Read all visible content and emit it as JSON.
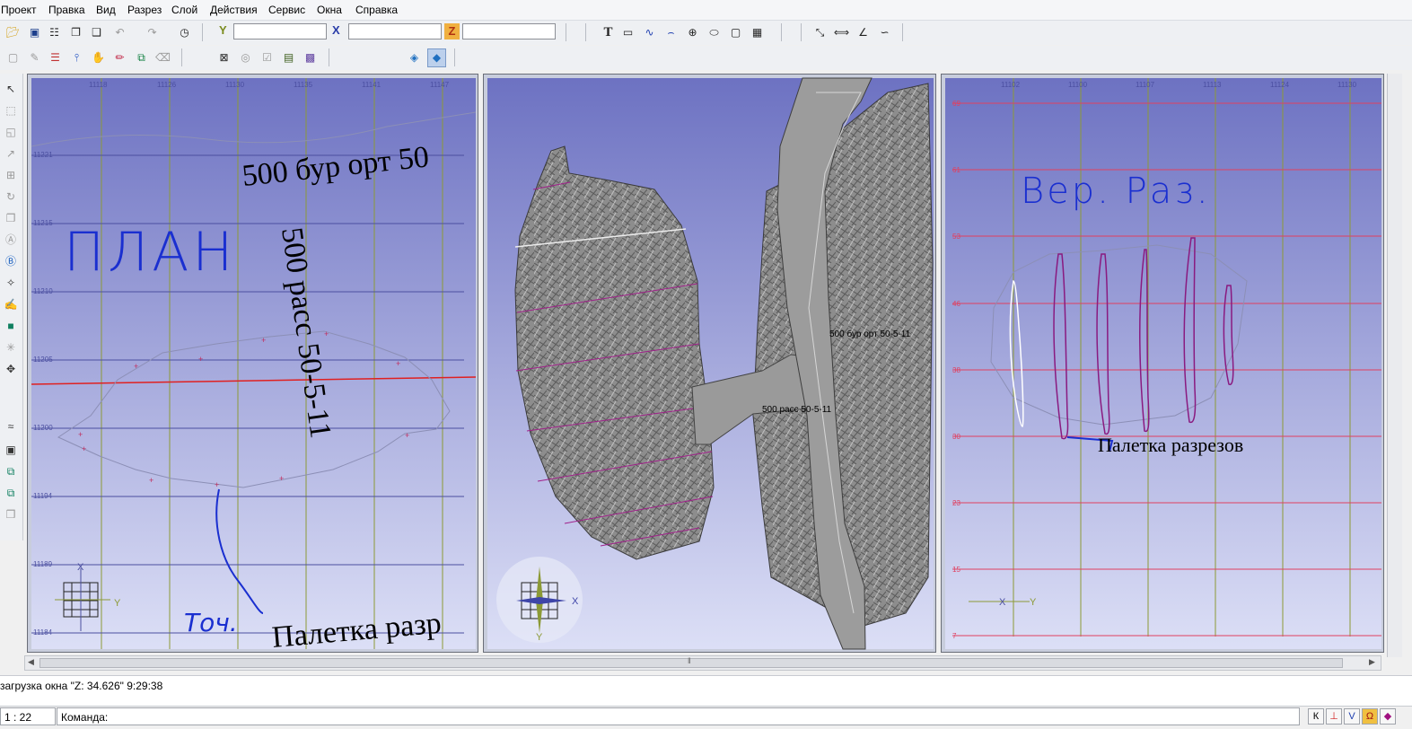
{
  "menu": {
    "items": [
      "Проект",
      "Правка",
      "Вид",
      "Разрез",
      "Слой",
      "Действия",
      "Сервис",
      "Окна",
      "Справка"
    ]
  },
  "toolbar": {
    "coord_y_label": "Y",
    "coord_x_label": "X",
    "coord_z_label": "Z",
    "coord_y_value": "",
    "coord_x_value": "",
    "coord_z_value": "",
    "text_tool_label": "T",
    "icons_row1": [
      "open-folder-icon",
      "save-icon",
      "save-as-icon",
      "print-icon",
      "copy-icon",
      "undo-icon",
      "redo-icon",
      "clock-icon"
    ],
    "draw_icons": [
      "text-icon",
      "rectangle-icon",
      "polyline-icon",
      "arc-icon",
      "circle-icon",
      "ellipse-icon",
      "frame-icon",
      "table-icon"
    ],
    "measure_icons": [
      "measure-line-icon",
      "dimension-icon",
      "angle-icon",
      "curve-icon"
    ]
  },
  "viewports": {
    "plan": {
      "y_labels": [
        "11221",
        "11215",
        "11210",
        "11205",
        "11200",
        "11194",
        "11189",
        "11184"
      ],
      "x_labels": [
        "11118",
        "11126",
        "11130",
        "11135",
        "11141",
        "11147"
      ],
      "text_drift": "500 бур орт 50",
      "text_pass": "500 расс 50-5-11",
      "text_palette": "Палетка разр",
      "hand_plan": "ПЛАН",
      "hand_toch": "Точ.",
      "axis_x": "X",
      "axis_y": "Y"
    },
    "view3d": {
      "label_drift": "500 бур орт 50-5-11",
      "label_pass": "500 расс 50-5-11",
      "axis_x": "X",
      "axis_y": "Y"
    },
    "section": {
      "y_labels": [
        "69",
        "61",
        "53",
        "46",
        "38",
        "30",
        "23",
        "15",
        "7"
      ],
      "x_labels": [
        "11102",
        "11100",
        "11107",
        "11113",
        "11124",
        "11130"
      ],
      "hand_title": "Вер. Раз.",
      "text_palette": "Палетка разрезов",
      "axis_x": "X",
      "axis_y": "Y"
    }
  },
  "status": {
    "message": "загрузка окна \"Z:  34.626\" 9:29:38",
    "scale": "1 : 22",
    "command_label": "Команда:",
    "snap_buttons": [
      "К",
      "⊥",
      "V",
      "Ω",
      "◆"
    ]
  },
  "colors": {
    "viewport_top": "#6f74c4",
    "viewport_bottom": "#d9dcf5",
    "grid_vertical": "#8c9a36",
    "grid_plan_horizontal": "#4b4fa0",
    "grid_section_horizontal": "#e04060",
    "section_curves": "#8a1a80",
    "handwriting": "#1a2fd0"
  }
}
